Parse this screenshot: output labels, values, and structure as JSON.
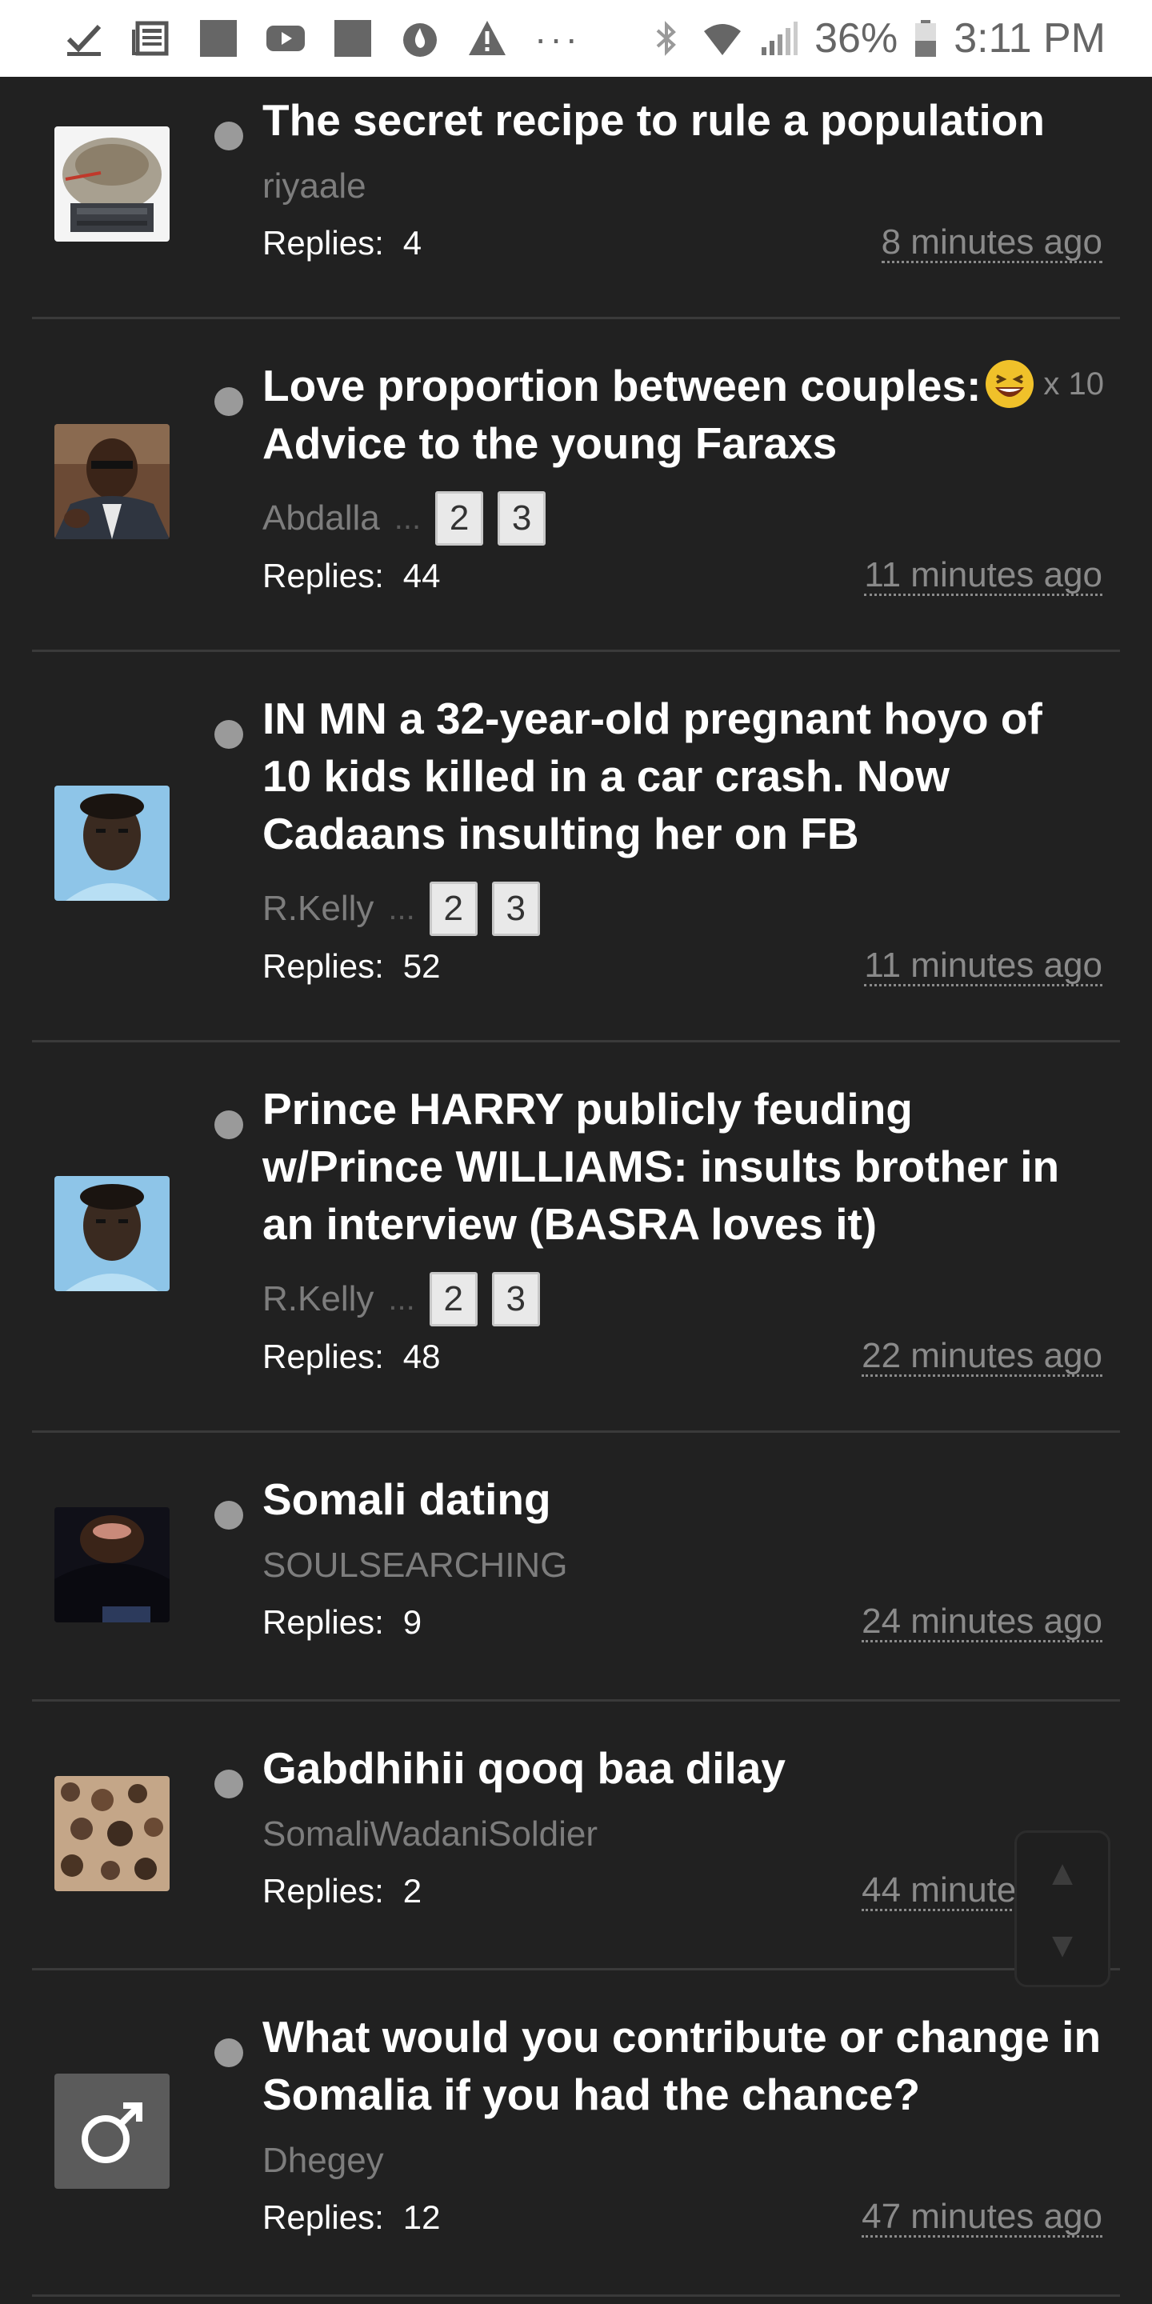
{
  "status_bar": {
    "battery": "36%",
    "time": "3:11 PM",
    "more": "···",
    "icons": [
      "check-icon",
      "news-icon",
      "square-icon",
      "youtube-icon",
      "square-icon",
      "flame-icon",
      "warning-icon",
      "bluetooth-icon",
      "wifi-icon",
      "signal-icon",
      "battery-icon"
    ]
  },
  "topics": [
    {
      "title": "The secret recipe to rule a population",
      "author": "riyaale",
      "replies_label": "Replies:",
      "replies": "4",
      "time": "8 minutes ago",
      "pages": []
    },
    {
      "title": "Love proportion between couples: Advice to the young Faraxs",
      "author": "Abdalla",
      "ellipsis": "...",
      "replies_label": "Replies:",
      "replies": "44",
      "time": "11 minutes ago",
      "pages": [
        "2",
        "3"
      ],
      "reaction": {
        "icon": "laughing-emoji-icon",
        "count": "x 10"
      }
    },
    {
      "title": "IN MN a 32-year-old pregnant hoyo of 10 kids killed in a car crash. Now Cadaans insulting her on FB",
      "author": "R.Kelly",
      "ellipsis": "...",
      "replies_label": "Replies:",
      "replies": "52",
      "time": "11 minutes ago",
      "pages": [
        "2",
        "3"
      ]
    },
    {
      "title": "Prince HARRY publicly feuding w/Prince WILLIAMS: insults brother in an interview (BASRA loves it)",
      "author": "R.Kelly",
      "ellipsis": "...",
      "replies_label": "Replies:",
      "replies": "48",
      "time": "22 minutes ago",
      "pages": [
        "2",
        "3"
      ]
    },
    {
      "title": "Somali dating",
      "author": "SOULSEARCHING",
      "replies_label": "Replies:",
      "replies": "9",
      "time": "24 minutes ago",
      "pages": []
    },
    {
      "title": "Gabdhihii qooq baa dilay",
      "author": "SomaliWadaniSoldier",
      "replies_label": "Replies:",
      "replies": "2",
      "time": "44 minutes ago",
      "pages": []
    },
    {
      "title": "What would you contribute or change in Somalia if you had the chance?",
      "author": "Dhegey",
      "replies_label": "Replies:",
      "replies": "12",
      "time": "47 minutes ago",
      "pages": []
    }
  ],
  "scroll_widget": {
    "up": "▲",
    "down": "▼"
  }
}
